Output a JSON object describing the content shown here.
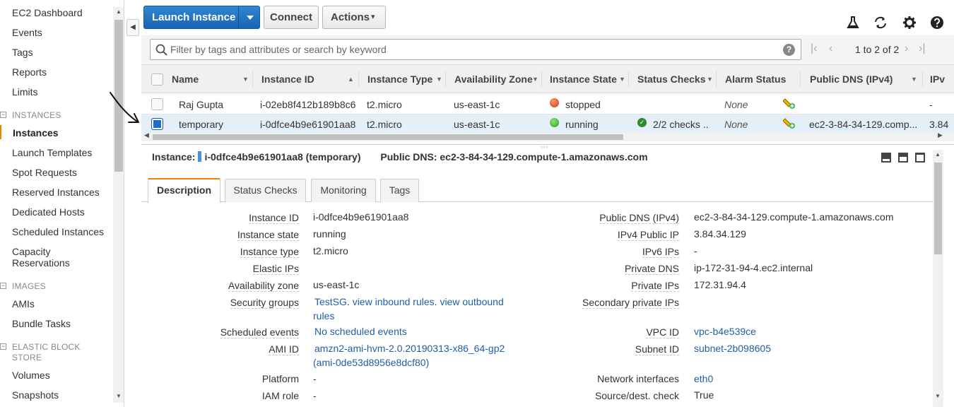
{
  "sidebar": {
    "items_top": [
      "EC2 Dashboard",
      "Events",
      "Tags",
      "Reports",
      "Limits"
    ],
    "instances_section": "INSTANCES",
    "instances_items": [
      "Instances",
      "Launch Templates",
      "Spot Requests",
      "Reserved Instances",
      "Dedicated Hosts",
      "Scheduled Instances",
      "Capacity",
      "Reservations"
    ],
    "images_section": "IMAGES",
    "images_items": [
      "AMIs",
      "Bundle Tasks"
    ],
    "ebs_section_line1": "ELASTIC BLOCK",
    "ebs_section_line2": "STORE",
    "ebs_items": [
      "Volumes",
      "Snapshots"
    ],
    "toggle_symbol": "−",
    "collapse_symbol": "◀"
  },
  "toolbar": {
    "launch_label": "Launch Instance",
    "connect_label": "Connect",
    "actions_label": "Actions",
    "actions_caret": "▾",
    "icons": [
      "beaker-icon",
      "refresh-icon",
      "gear-icon",
      "help-icon"
    ]
  },
  "filter": {
    "placeholder": "Filter by tags and attributes or search by keyword",
    "help_symbol": "?",
    "pager_text": "1 to 2 of 2",
    "first": "|‹",
    "prev": "‹",
    "next": "›",
    "last": "›|"
  },
  "table": {
    "columns": [
      "Name",
      "Instance ID",
      "Instance Type",
      "Availability Zone",
      "Instance State",
      "Status Checks",
      "Alarm Status",
      "Public DNS (IPv4)",
      "IPv"
    ],
    "rows": [
      {
        "name": "Raj Gupta",
        "instance_id": "i-02eb8f412b189b8c6",
        "type": "t2.micro",
        "az": "us-east-1c",
        "state": "stopped",
        "status_checks": "",
        "alarm": "None",
        "public_dns": "",
        "ipv": "-"
      },
      {
        "name": "temporary",
        "instance_id": "i-0dfce4b9e61901aa8",
        "type": "t2.micro",
        "az": "us-east-1c",
        "state": "running",
        "status_checks": "2/2 checks ...",
        "alarm": "None",
        "public_dns": "ec2-3-84-34-129.comp...",
        "ipv": "3.84"
      }
    ]
  },
  "detail": {
    "instance_label": "Instance:",
    "instance_value": "i-0dfce4b9e61901aa8 (temporary)",
    "public_dns_label": "Public DNS:",
    "public_dns_value": "ec2-3-84-34-129.compute-1.amazonaws.com",
    "tabs": [
      "Description",
      "Status Checks",
      "Monitoring",
      "Tags"
    ],
    "grip": "▫▫▫"
  },
  "description": {
    "left": [
      {
        "label": "Instance ID",
        "value": "i-0dfce4b9e61901aa8"
      },
      {
        "label": "Instance state",
        "value": "running"
      },
      {
        "label": "Instance type",
        "value": "t2.micro"
      },
      {
        "label": "Elastic IPs",
        "value": ""
      },
      {
        "label": "Availability zone",
        "value": "us-east-1c"
      },
      {
        "label": "Security groups",
        "value": ""
      },
      {
        "label": "Scheduled events",
        "value": "No scheduled events"
      },
      {
        "label": "AMI ID",
        "value": "amzn2-ami-hvm-2.0.20190313-x86_64-gp2"
      },
      {
        "label": "Platform",
        "value": "-"
      },
      {
        "label": "IAM role",
        "value": "-"
      }
    ],
    "security_groups": {
      "sg": "TestSG",
      "sep1": ".",
      "inbound": "view inbound rules",
      "sep2": ".",
      "outbound": "view outbound",
      "rules": "rules"
    },
    "ami_line2": "(ami-0de53d8956e8dcf80)",
    "right": [
      {
        "label": "Public DNS (IPv4)",
        "value": "ec2-3-84-34-129.compute-1.amazonaws.com"
      },
      {
        "label": "IPv4 Public IP",
        "value": "3.84.34.129"
      },
      {
        "label": "IPv6 IPs",
        "value": "-"
      },
      {
        "label": "Private DNS",
        "value": "ip-172-31-94-4.ec2.internal"
      },
      {
        "label": "Private IPs",
        "value": "172.31.94.4"
      },
      {
        "label": "Secondary private IPs",
        "value": ""
      },
      {
        "label": "VPC ID",
        "value": "vpc-b4e539ce"
      },
      {
        "label": "Subnet ID",
        "value": "subnet-2b098605"
      },
      {
        "label": "Network interfaces",
        "value": "eth0"
      },
      {
        "label": "Source/dest. check",
        "value": "True"
      }
    ]
  },
  "colors": {
    "primary": "#1a64b4",
    "tab_accent": "#e8830a",
    "selected_row": "#e4effa",
    "link": "#1f5fa5",
    "stopped": "#d0341a",
    "running": "#2a9f1e"
  }
}
